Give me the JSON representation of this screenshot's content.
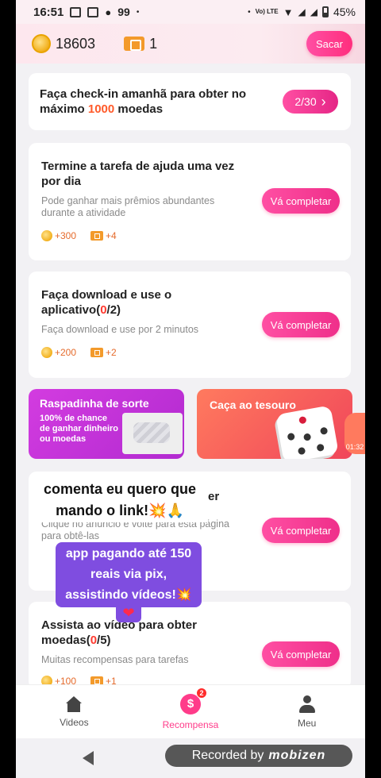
{
  "status_bar": {
    "time": "16:51",
    "notif_count": "99",
    "dot": "•",
    "network": "Vo) LTE",
    "battery": "45%"
  },
  "header": {
    "coins": "18603",
    "tickets": "1",
    "withdraw_label": "Sacar"
  },
  "checkin": {
    "text_before": "Faça check-in amanhã para obter no máximo ",
    "highlight": "1000",
    "text_after": " moedas",
    "progress": "2/30",
    "chevron": "›"
  },
  "tasks": [
    {
      "title": "Termine a tarefa de ajuda uma vez por dia",
      "desc": "Pode ganhar mais prêmios abundantes durante a atividade",
      "coins": "+300",
      "tickets": "+4",
      "button": "Vá completar"
    },
    {
      "title_before": "Faça download e use o aplicativo(",
      "title_hl": "0",
      "title_after": "/2)",
      "desc": "Faça download e use por 2 minutos",
      "coins": "+200",
      "tickets": "+2",
      "button": "Vá completar"
    },
    {
      "title_visible": "er",
      "desc": "Clique no anúncio e volte para esta página para obtê-las",
      "button": "Vá completar"
    },
    {
      "title_before": "Assista ao vídeo para obter moedas(",
      "title_hl": "0",
      "title_after": "/5)",
      "desc": "Muitas recompensas para tarefas",
      "coins": "+100",
      "tickets": "+1",
      "button": "Vá completar"
    }
  ],
  "banners": {
    "raspadinha_title": "Raspadinha de sorte",
    "raspadinha_desc": "100% de chance de ganhar dinheiro ou moedas",
    "tesouro_title": "Caça ao tesouro",
    "video_time": "01:32"
  },
  "overlay": {
    "caption1": "comenta eu quero que mando o link!💥🙏",
    "caption2": "app pagando até 150 reais via pix, assistindo vídeos!💥",
    "heart": "❤"
  },
  "bottom_nav": {
    "videos": "Videos",
    "recompensa": "Recompensa",
    "recompensa_badge": "2",
    "meu": "Meu",
    "money_symbol": "$"
  },
  "recorder": {
    "label": "Recorded by",
    "brand": "mobizen"
  },
  "colors": {
    "accent": "#ff3c8a",
    "highlight": "#ff5a2a",
    "reward": "#e56b2c"
  }
}
